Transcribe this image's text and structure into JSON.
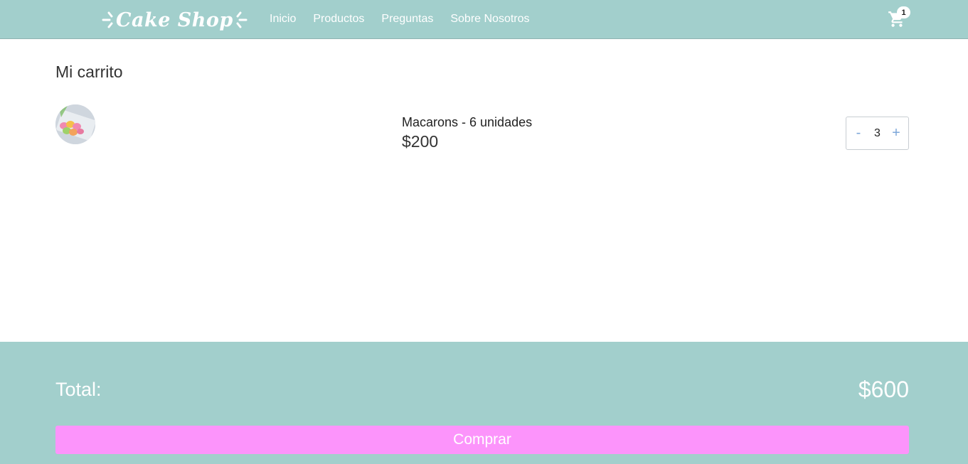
{
  "header": {
    "brand": "Cake Shop",
    "nav": [
      {
        "label": "Inicio"
      },
      {
        "label": "Productos"
      },
      {
        "label": "Preguntas"
      },
      {
        "label": "Sobre Nosotros"
      }
    ],
    "cart_icon": "shopping-cart-icon",
    "cart_count": "1"
  },
  "cart": {
    "title": "Mi carrito",
    "items": [
      {
        "name": "Macarons - 6 unidades",
        "price": "$200",
        "quantity": "3",
        "decrement_label": "-",
        "increment_label": "+",
        "thumbnail": "macarons-image"
      }
    ]
  },
  "summary": {
    "total_label": "Total:",
    "total_value": "$600",
    "buy_label": "Comprar"
  },
  "colors": {
    "primary": "#a2cfcc",
    "buy_button": "#fc94fb",
    "stepper_accent": "#7da7d9"
  }
}
